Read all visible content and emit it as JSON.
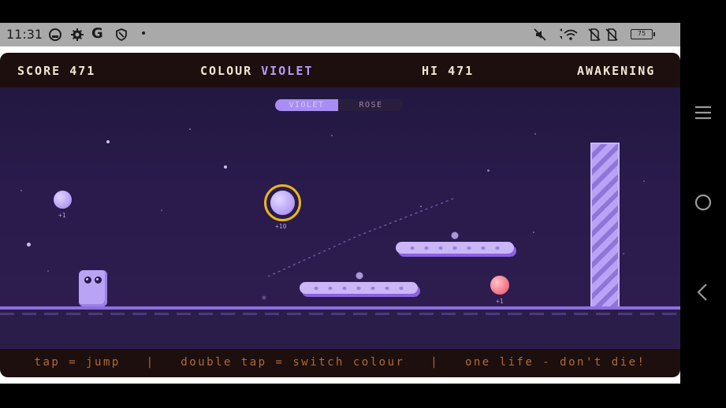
{
  "status_bar": {
    "time": "11:31",
    "icons": [
      "cloud-sync-icon",
      "gear-icon",
      "google-icon",
      "shield-icon",
      "dot-icon",
      "mute-icon",
      "wifi-icon",
      "sim-off-icon",
      "sim-off-icon"
    ],
    "google_letter": "G",
    "dot": "•",
    "battery": "75"
  },
  "hud": {
    "score_label": "SCORE",
    "score_value": "471",
    "colour_label": "COLOUR",
    "colour_value": "VIOLET",
    "hi_label": "HI",
    "hi_value": "471",
    "stage": "AWAKENING"
  },
  "colour_toggle": {
    "options": [
      "VIOLET",
      "ROSE"
    ],
    "selected": "VIOLET"
  },
  "orbs": [
    {
      "name": "violet-orb",
      "label": "+1"
    },
    {
      "name": "bonus-orb",
      "label": "+10"
    },
    {
      "name": "rose-orb",
      "label": "+1"
    }
  ],
  "footer_hint": "tap = jump   |   double tap = switch colour   |   one life - don't die!",
  "colors": {
    "violet": "#b9a3f5",
    "rose": "#f47a8a",
    "gold_ring": "#e8b81a",
    "hud_text": "#f1e7d2",
    "hint_text": "#b06a38"
  }
}
